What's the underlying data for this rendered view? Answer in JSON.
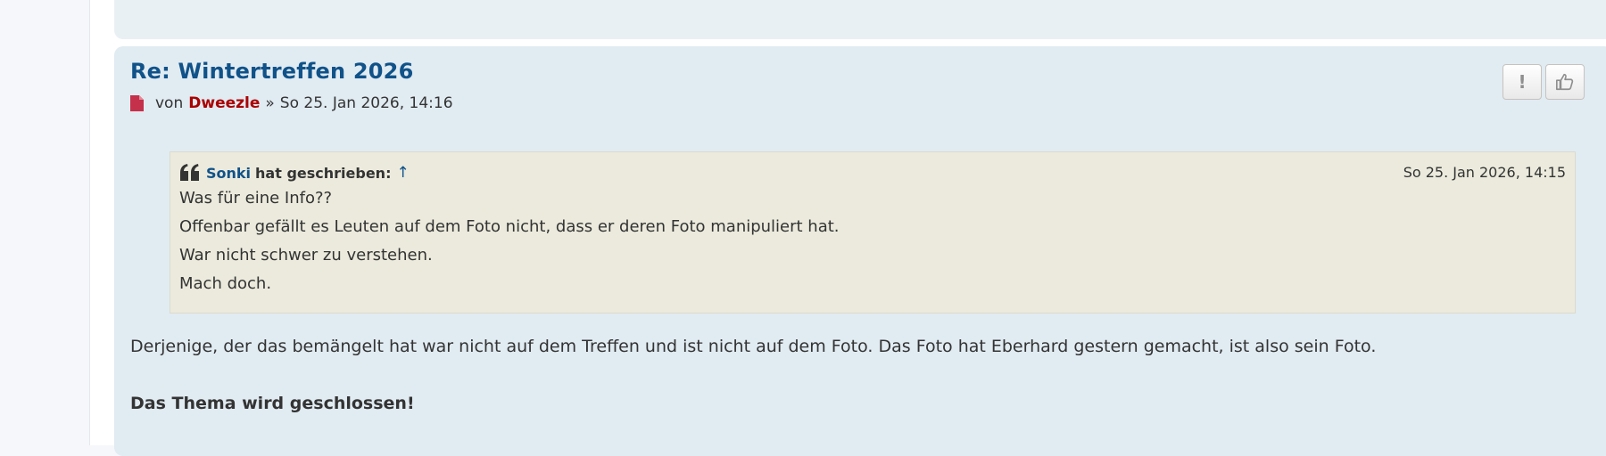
{
  "post": {
    "title": "Re: Wintertreffen 2026",
    "by_label": "von",
    "author": "Dweezle",
    "separator": "»",
    "timestamp": "So 25. Jan 2026, 14:16",
    "colors": {
      "title": "#105289",
      "author": "#aa0000",
      "background": "#e1ebf2"
    },
    "buttons": [
      {
        "icon": "exclamation-icon",
        "glyph": "!"
      },
      {
        "icon": "thumbs-up-icon"
      }
    ],
    "quote": {
      "author": "Sonki",
      "says": "hat geschrieben:",
      "arrow": "↑",
      "timestamp": "So 25. Jan 2026, 14:15",
      "lines": [
        "Was für eine Info??",
        "Offenbar gefällt es Leuten auf dem Foto nicht, dass er deren Foto manipuliert hat.",
        "War nicht schwer zu verstehen.",
        "Mach doch."
      ]
    },
    "body": "Derjenige, der das bemängelt hat war nicht auf dem Treffen und ist nicht auf dem Foto. Das Foto hat Eberhard gestern gemacht, ist also sein Foto.",
    "closing": "Das Thema wird geschlossen!"
  }
}
